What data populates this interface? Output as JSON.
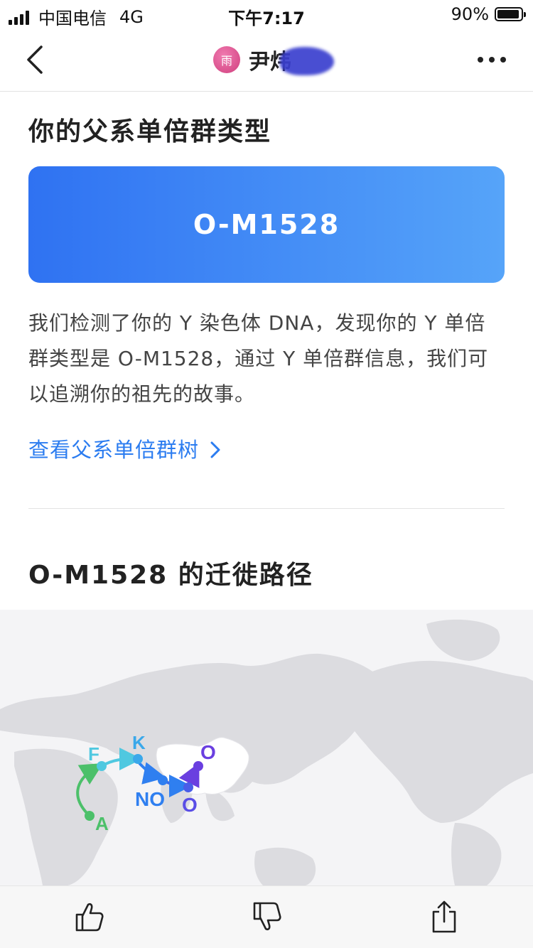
{
  "status_bar": {
    "carrier": "中国电信",
    "network": "4G",
    "time": "下午7:17",
    "battery": "90%"
  },
  "nav": {
    "avatar_char": "雨",
    "name": "尹炜"
  },
  "section1": {
    "title": "你的父系单倍群类型",
    "haplogroup": "O-M1528",
    "description": "我们检测了你的 Y 染色体 DNA，发现你的 Y 单倍群类型是 O-M1528，通过 Y 单倍群信息，我们可以追溯你的祖先的故事。",
    "link": "查看父系单倍群树"
  },
  "section2": {
    "title": "O-M1528 的迁徙路径",
    "map_labels": {
      "a": "A",
      "f": "F",
      "k": "K",
      "no": "NO",
      "o1": "O",
      "o2": "O"
    }
  },
  "colors": {
    "accent_blue": "#2b7cf0",
    "card_start": "#2f72f2",
    "card_end": "#56a4f9",
    "green": "#4cc06a",
    "teal": "#4fc8e0",
    "blue": "#2f7ff0",
    "purple": "#6a3fe0"
  },
  "icons": {
    "back": "chevron-left-icon",
    "more": "more-dots-icon",
    "like": "thumbs-up-icon",
    "dislike": "thumbs-down-icon",
    "share": "share-icon"
  }
}
